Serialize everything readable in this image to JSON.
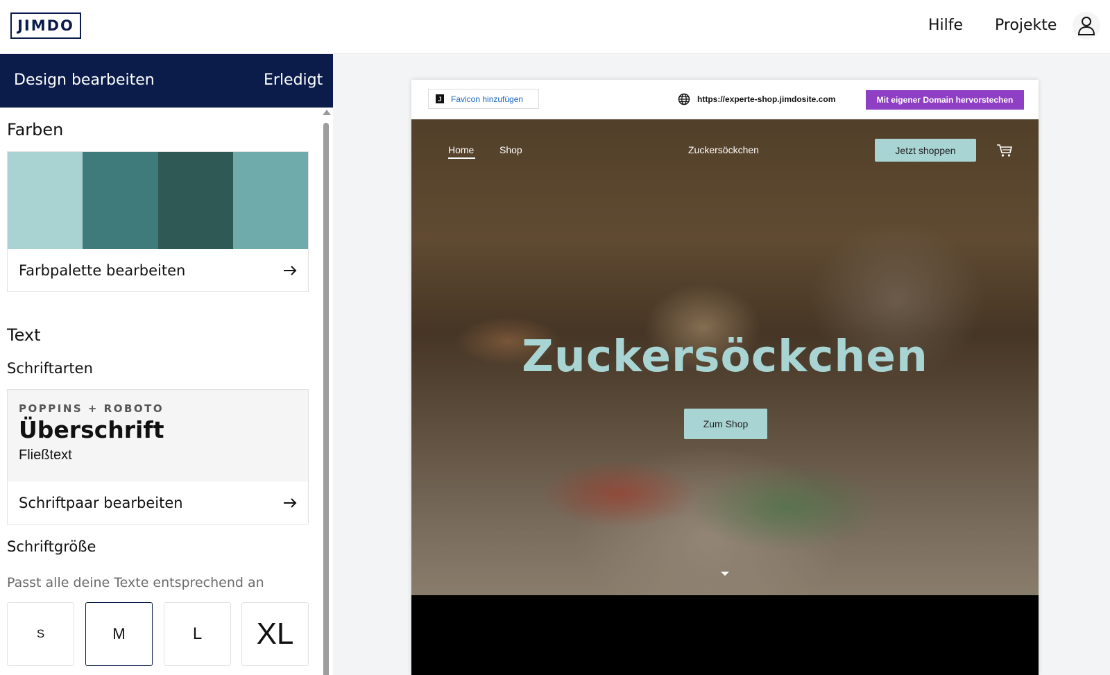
{
  "topbar": {
    "logo": "JIMDO",
    "help": "Hilfe",
    "projects": "Projekte",
    "account_icon": "user-icon"
  },
  "panel": {
    "title": "Design bearbeiten",
    "done": "Erledigt",
    "colors": {
      "heading": "Farben",
      "swatches": [
        "#a9d2d2",
        "#3f7b7a",
        "#2e5954",
        "#6fabaa"
      ],
      "action": "Farbpalette bearbeiten",
      "action_icon": "arrow-right-icon"
    },
    "text": {
      "heading": "Text",
      "fonts_label": "Schriftarten",
      "font_pair": "POPPINS + ROBOTO",
      "heading_sample": "Überschrift",
      "body_sample": "Fließtext",
      "action": "Schriftpaar bearbeiten",
      "action_icon": "arrow-right-icon"
    },
    "size": {
      "label": "Schriftgröße",
      "description": "Passt alle deine Texte entsprechend an",
      "options": [
        "S",
        "M",
        "L",
        "XL"
      ],
      "selected": "M"
    }
  },
  "preview": {
    "favicon_button": "Favicon hinzufügen",
    "url": "https://experte-shop.jimdosite.com",
    "domain_button": "Mit eigener Domain hervorstechen",
    "nav": [
      "Home",
      "Shop"
    ],
    "site_name": "Zuckersöckchen",
    "cta_top": "Jetzt shoppen",
    "hero_title": "Zuckersöckchen",
    "hero_button": "Zum Shop",
    "accent": "#a8d5d3"
  }
}
